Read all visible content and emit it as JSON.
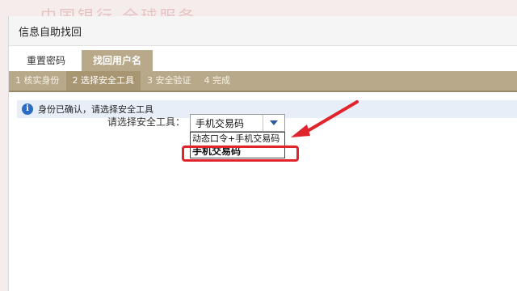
{
  "background": {
    "banner": "中国银行 全球服务"
  },
  "window": {
    "title": "信息自助找回"
  },
  "tabs": [
    {
      "label": "重置密码",
      "active": false
    },
    {
      "label": "找回用户名",
      "active": true
    }
  ],
  "steps": [
    {
      "label": "1 核实身份",
      "active": false
    },
    {
      "label": "2 选择安全工具",
      "active": true
    },
    {
      "label": "3 安全验证",
      "active": false
    },
    {
      "label": "4 完成",
      "active": false
    }
  ],
  "info": {
    "icon": "info-icon",
    "text": "身份已确认，请选择安全工具"
  },
  "form": {
    "label": "请选择安全工具：",
    "selected": "手机交易码",
    "options": [
      "动态口令+手机交易码",
      "手机交易码"
    ]
  },
  "colors": {
    "accent": "#b9a98b",
    "annotation": "#e0242c",
    "info_blue": "#2b6cc4"
  }
}
